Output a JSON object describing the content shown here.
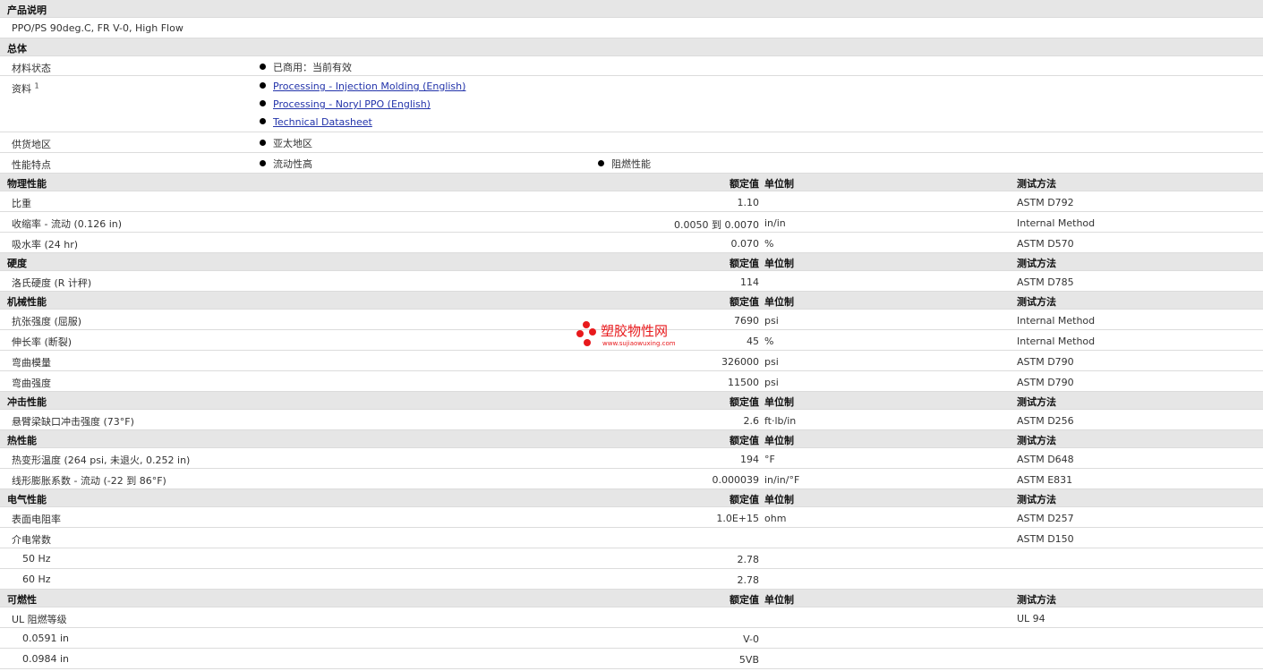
{
  "product": {
    "header": "产品说明",
    "description": "PPO/PS 90deg.C, FR V-0, High Flow"
  },
  "general": {
    "header": "总体",
    "status_label": "材料状态",
    "status_value": "已商用：当前有效",
    "docs_label": "资料",
    "docs_sup": "1",
    "docs": [
      "Processing - Injection Molding (English)",
      "Processing - Noryl PPO (English)",
      "Technical Datasheet"
    ],
    "region_label": "供货地区",
    "region_value": "亚太地区",
    "features_label": "性能特点",
    "features": [
      "流动性高",
      "阻燃性能"
    ]
  },
  "col_headers": {
    "value": "额定值",
    "unit": "单位制",
    "test": "测试方法"
  },
  "physical": {
    "header": "物理性能",
    "rows": [
      {
        "name": "比重",
        "value": "1.10",
        "unit": "",
        "test": "ASTM D792"
      },
      {
        "name": "收缩率  - 流动  (0.126 in)",
        "value": "0.0050 到  0.0070",
        "unit": "in/in",
        "test": "Internal Method"
      },
      {
        "name": "吸水率  (24 hr)",
        "value": "0.070",
        "unit": "%",
        "test": "ASTM D570"
      }
    ]
  },
  "hardness": {
    "header": "硬度",
    "rows": [
      {
        "name": "洛氏硬度  (R 计秤)",
        "value": "114",
        "unit": "",
        "test": "ASTM D785"
      }
    ]
  },
  "mechanical": {
    "header": "机械性能",
    "rows": [
      {
        "name": "抗张强度  (屈服)",
        "value": "7690",
        "unit": "psi",
        "test": "Internal Method"
      },
      {
        "name": "伸长率  (断裂)",
        "value": "45",
        "unit": "%",
        "test": "Internal Method"
      },
      {
        "name": "弯曲模量",
        "value": "326000",
        "unit": "psi",
        "test": "ASTM D790"
      },
      {
        "name": "弯曲强度",
        "value": "11500",
        "unit": "psi",
        "test": "ASTM D790"
      }
    ]
  },
  "impact": {
    "header": "冲击性能",
    "rows": [
      {
        "name": "悬臂梁缺口冲击强度  (73°F)",
        "value": "2.6",
        "unit": "ft·lb/in",
        "test": "ASTM D256"
      }
    ]
  },
  "thermal": {
    "header": "热性能",
    "rows": [
      {
        "name": "热变形温度  (264 psi, 未退火, 0.252 in)",
        "value": "194",
        "unit": "°F",
        "test": "ASTM D648"
      },
      {
        "name": "线形膨胀系数  - 流动  (-22 到  86°F)",
        "value": "0.000039",
        "unit": "in/in/°F",
        "test": "ASTM E831"
      }
    ]
  },
  "electrical": {
    "header": "电气性能",
    "rows": [
      {
        "name": "表面电阻率",
        "value": "1.0E+15",
        "unit": "ohm",
        "test": "ASTM D257"
      },
      {
        "name": "介电常数",
        "value": "",
        "unit": "",
        "test": "ASTM D150"
      },
      {
        "name": "50 Hz",
        "value": "2.78",
        "unit": "",
        "test": "",
        "sub": true
      },
      {
        "name": "60 Hz",
        "value": "2.78",
        "unit": "",
        "test": "",
        "sub": true
      }
    ]
  },
  "flammability": {
    "header": "可燃性",
    "rows": [
      {
        "name": "UL 阻燃等级",
        "value": "",
        "unit": "",
        "test": "UL 94"
      },
      {
        "name": "0.0591 in",
        "value": "V-0",
        "unit": "",
        "test": "",
        "sub": true
      },
      {
        "name": "0.0984 in",
        "value": "5VB",
        "unit": "",
        "test": "",
        "sub": true
      }
    ]
  },
  "watermark": {
    "cn": "塑胶物性网",
    "en": "www.sujiaowuxing.com",
    "color": "#e8191c"
  },
  "colors": {
    "header_bg": "#e6e6e6",
    "link": "#2233aa",
    "border": "#dcdcdc"
  }
}
